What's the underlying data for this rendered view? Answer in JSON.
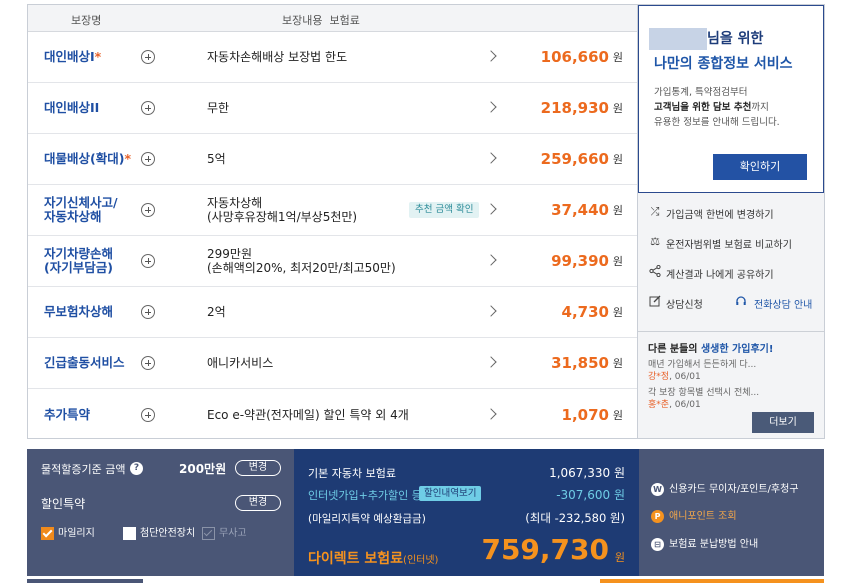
{
  "coverage": {
    "header_name": "보장명",
    "header_content": "보장내용  보험료",
    "rows": [
      {
        "name": "대인배상I",
        "star": "*",
        "content": "자동차손해배상 보장법 한도",
        "badge": "",
        "price": "106,660",
        "unit": "원"
      },
      {
        "name": "대인배상II",
        "star": "",
        "content": "무한",
        "badge": "",
        "price": "218,930",
        "unit": "원"
      },
      {
        "name": "대물배상(확대)",
        "star": "*",
        "content": "5억",
        "badge": "",
        "price": "259,660",
        "unit": "원"
      },
      {
        "name": "자기신체사고/\n자동차상해",
        "star": "",
        "content": "자동차상해\n(사망후유장해1억/부상5천만)",
        "badge": "추천 금액 확인",
        "price": "37,440",
        "unit": "원"
      },
      {
        "name": "자기차량손해\n(자기부담금)",
        "star": "",
        "content": "299만원\n(손해액의20%, 최저20만/최고50만)",
        "badge": "",
        "price": "99,390",
        "unit": "원"
      },
      {
        "name": "무보험차상해",
        "star": "",
        "content": "2억",
        "badge": "",
        "price": "4,730",
        "unit": "원"
      },
      {
        "name": "긴급출동서비스",
        "star": "",
        "content": "애니카서비스",
        "badge": "",
        "price": "31,850",
        "unit": "원"
      },
      {
        "name": "추가특약",
        "star": "",
        "content": "Eco e-약관(전자메일) 할인 특약 외 4개",
        "badge": "",
        "price": "1,070",
        "unit": "원"
      }
    ]
  },
  "promo": {
    "title1": "님을 위한",
    "title2": "나만의 종합정보 서비스",
    "desc1": "가입통계, 특약점검부터",
    "desc2_bold": "고객님을 위한 담보 추천",
    "desc2_rest": "까지",
    "desc3": "유용한 정보를 안내해 드립니다.",
    "button": "확인하기"
  },
  "links": [
    {
      "icon": "shuffle-icon",
      "glyph": "⤮",
      "label": "가입금액 한번에 변경하기"
    },
    {
      "icon": "scale-icon",
      "glyph": "⚖",
      "label": "운전자범위별 보험료 비교하기"
    },
    {
      "icon": "share-icon",
      "glyph": "⟨",
      "label": "계산결과 나에게 공유하기"
    }
  ],
  "consult": {
    "label": "상담신청",
    "phone_label": "전화상담 안내"
  },
  "reviews": {
    "title_pre": "다른 분들의 ",
    "title_hl": "생생한 가입후기!",
    "items": [
      {
        "text": "매년 가입해서 든든하게 다...",
        "author": "강*정",
        "date": ", 06/01"
      },
      {
        "text": "각 보장 항목별 선택시 전체...",
        "author": "홍*춘",
        "date": ", 06/01"
      }
    ],
    "more": "더보기"
  },
  "bottom": {
    "standard_label": "물적할증기준 금액",
    "standard_amount": "200만원",
    "change": "변경",
    "discount_label": "할인특약",
    "change2": "변경",
    "options": [
      {
        "label": "마일리지",
        "state": "on"
      },
      {
        "label": "첨단안전장치",
        "state": "off"
      },
      {
        "label": "무사고",
        "state": "disabled"
      }
    ],
    "base_label": "기본 자동차 보험료",
    "base_value": "1,067,330 원",
    "disc_label": "인터넷가입+추가할인 등",
    "disc_tag": "할인내역보기",
    "disc_value": "-307,600 원",
    "mileage_label": "(마일리지특약 예상환급금)",
    "mileage_value": "(최대 -232,580 원)",
    "total_label": "다이렉트 보험료",
    "total_sub": "(인터넷)",
    "total_value": "759,730",
    "total_unit": "원",
    "side": [
      {
        "icon": "won-icon",
        "glyph": "W",
        "label": "신용카드 무이자/포인트/후청구"
      },
      {
        "icon": "point-icon",
        "glyph": "P",
        "label": "애니포인트 조회"
      },
      {
        "icon": "pay-info-icon",
        "glyph": "⊟",
        "label": "보험료 분납방법 안내"
      }
    ]
  }
}
